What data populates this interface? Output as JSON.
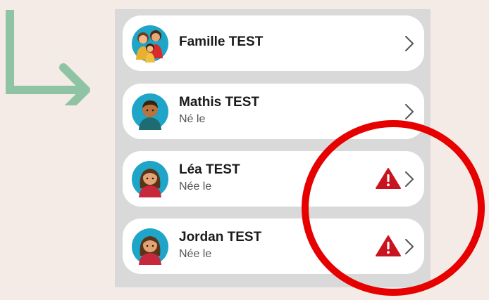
{
  "list": {
    "items": [
      {
        "name": "Famille TEST",
        "subtitle": "",
        "avatar": "family-avatar-icon",
        "warning": false
      },
      {
        "name": "Mathis TEST",
        "subtitle": "Né le",
        "avatar": "boy-avatar-icon",
        "warning": false
      },
      {
        "name": "Léa TEST",
        "subtitle": "Née le",
        "avatar": "girl-avatar-icon",
        "warning": true
      },
      {
        "name": "Jordan TEST",
        "subtitle": "Née le",
        "avatar": "girl-avatar-icon",
        "warning": true
      }
    ]
  },
  "icons": {
    "chevron": "chevron-right-icon",
    "warning": "warning-triangle-icon",
    "arrow": "arrow-down-right-icon"
  },
  "colors": {
    "background": "#f5ebe6",
    "panel": "#d9d9d9",
    "card": "#ffffff",
    "arrow": "#8ec3a4",
    "highlight_circle": "#e60000",
    "warning": "#c8141e",
    "avatar_bg": "#1ea5c8"
  }
}
